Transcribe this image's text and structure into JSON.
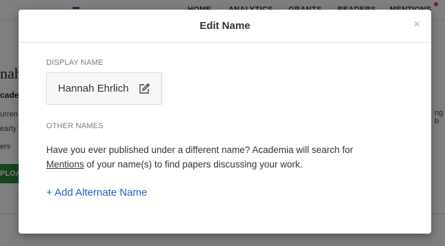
{
  "background": {
    "nav_items": [
      "HOME",
      "ANALYTICS",
      "GRANTS",
      "READERS",
      "MENTIONS"
    ],
    "name_fragment": "nah",
    "affiliation_fragment": "cade",
    "text_lines": [
      "urren",
      "early",
      "ers"
    ],
    "upload_label": "PLOA",
    "right_fragment": "ng b"
  },
  "modal": {
    "title": "Edit Name",
    "close_symbol": "×",
    "display_name_label": "DISPLAY NAME",
    "display_name_value": "Hannah Ehrlich",
    "other_names_label": "OTHER NAMES",
    "description_before": "Have you ever published under a different name? Academia will search for ",
    "description_link": "Mentions",
    "description_after": " of your name(s) to find papers discussing your work.",
    "add_alternate_label": "+ Add Alternate Name"
  },
  "icons": {
    "edit": "edit-pencil-icon",
    "close": "close-icon"
  },
  "colors": {
    "link_blue": "#1f5ec4",
    "upload_green": "#2e8b3a",
    "notification_red": "#e34b3a"
  }
}
